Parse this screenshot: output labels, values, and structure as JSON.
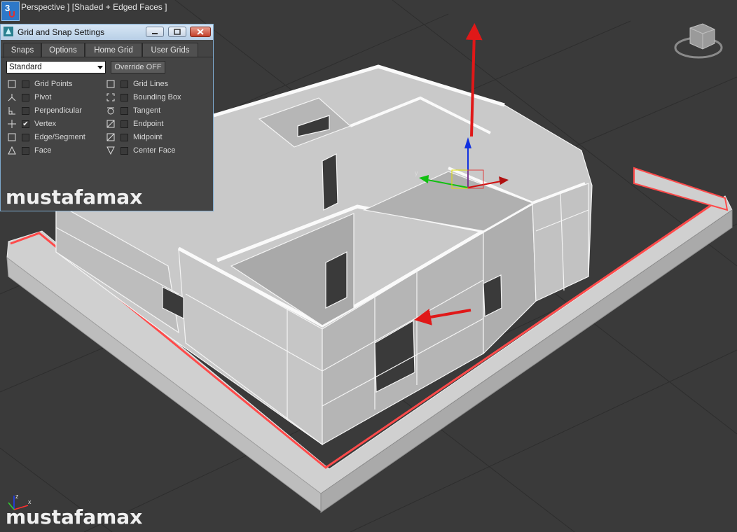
{
  "viewport": {
    "label": "Perspective ] [Shaded + Edged Faces ]",
    "snap_toggle": "3",
    "watermark": "mustafamax",
    "axis_x": "x",
    "axis_y": "y",
    "axis_z": "z"
  },
  "dialog": {
    "title": "Grid and Snap Settings",
    "tabs": [
      "Snaps",
      "Options",
      "Home Grid",
      "User Grids"
    ],
    "active_tab": "Snaps",
    "dropdown_value": "Standard",
    "override_label": "Override OFF",
    "options": [
      {
        "label": "Grid Points",
        "checked": false,
        "icon": "square-snap-icon"
      },
      {
        "label": "Pivot",
        "checked": false,
        "icon": "pivot-snap-icon"
      },
      {
        "label": "Perpendicular",
        "checked": false,
        "icon": "perpendicular-snap-icon"
      },
      {
        "label": "Vertex",
        "checked": true,
        "icon": "vertex-snap-icon"
      },
      {
        "label": "Edge/Segment",
        "checked": false,
        "icon": "edge-snap-icon"
      },
      {
        "label": "Face",
        "checked": false,
        "icon": "face-snap-icon"
      },
      {
        "label": "Grid Lines",
        "checked": false,
        "icon": "grid-lines-snap-icon"
      },
      {
        "label": "Bounding Box",
        "checked": false,
        "icon": "bounding-box-snap-icon"
      },
      {
        "label": "Tangent",
        "checked": false,
        "icon": "tangent-snap-icon"
      },
      {
        "label": "Endpoint",
        "checked": false,
        "icon": "endpoint-snap-icon"
      },
      {
        "label": "Midpoint",
        "checked": false,
        "icon": "midpoint-snap-icon"
      },
      {
        "label": "Center Face",
        "checked": false,
        "icon": "center-face-snap-icon"
      }
    ]
  },
  "colors": {
    "viewport_bg": "#3a3a3a",
    "wall": "#c8c8c8",
    "selected_outline": "#ff4a4a",
    "annotation_arrow": "#e01818",
    "gizmo_x": "#d01010",
    "gizmo_y": "#10c010",
    "gizmo_z": "#1030e0"
  }
}
